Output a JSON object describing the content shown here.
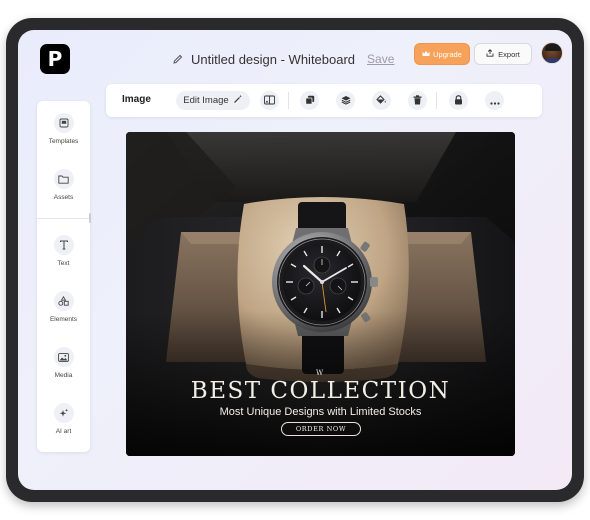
{
  "app": {
    "logo_letter": "P",
    "document_title": "Untitled design - Whiteboard",
    "save_label": "Save",
    "upgrade_label": "Upgrade",
    "export_label": "Export"
  },
  "toolbar": {
    "context_label": "Image",
    "edit_image_label": "Edit Image",
    "icons": [
      "image-swap-icon",
      "duplicate-icon",
      "layers-icon",
      "fill-color-icon",
      "trash-icon",
      "lock-icon",
      "more-icon"
    ]
  },
  "sidebar": {
    "items": [
      {
        "label": "Templates",
        "icon": "templates-icon"
      },
      {
        "label": "Assets",
        "icon": "folder-icon"
      },
      {
        "label": "Text",
        "icon": "text-icon"
      },
      {
        "label": "Elements",
        "icon": "shapes-icon"
      },
      {
        "label": "Media",
        "icon": "image-icon"
      },
      {
        "label": "AI art",
        "icon": "sparkle-icon"
      }
    ]
  },
  "canvas": {
    "brand_mark": "W",
    "headline": "BEST COLLECTION",
    "subline": "Most Unique Designs with Limited Stocks",
    "cta": "ORDER NOW"
  },
  "colors": {
    "upgrade_bg": "#f7a25a",
    "device_frame": "#2a2a2c",
    "screen_bg_start": "#e9ecfb",
    "screen_bg_end": "#f3eaf6"
  }
}
